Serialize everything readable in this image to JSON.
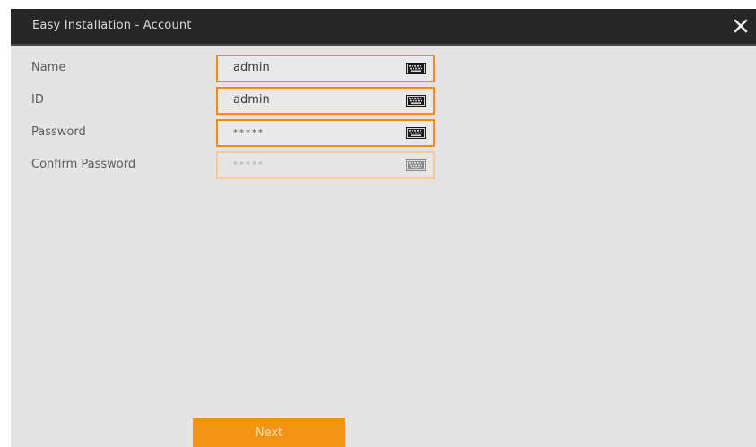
{
  "window": {
    "title": "Easy Installation - Account"
  },
  "form": {
    "fields": [
      {
        "label": "Name",
        "value": "admin",
        "masked": false,
        "enabled": true
      },
      {
        "label": "ID",
        "value": "admin",
        "masked": false,
        "enabled": true
      },
      {
        "label": "Password",
        "value": "*****",
        "masked": true,
        "enabled": true
      },
      {
        "label": "Confirm Password",
        "value": "*****",
        "masked": true,
        "enabled": false
      }
    ]
  },
  "actions": {
    "next_label": "Next"
  },
  "icons": {
    "close": "close-icon",
    "keyboard": "keyboard-icon"
  },
  "colors": {
    "accent": "#f39316",
    "field_border": "#f08a1c",
    "title_bar": "#262626",
    "background": "#e4e4e4"
  }
}
